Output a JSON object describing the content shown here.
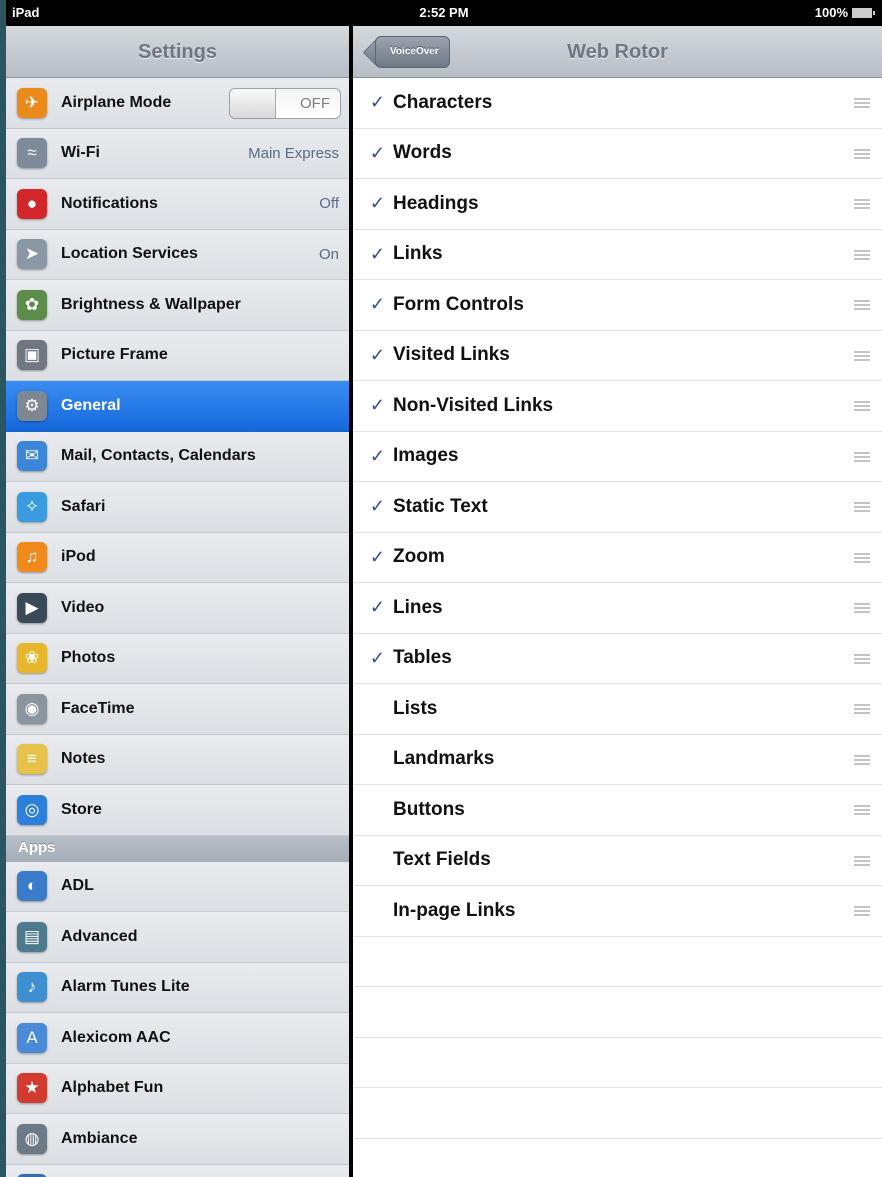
{
  "status": {
    "carrier": "iPad",
    "time": "2:52 PM",
    "battery": "100%"
  },
  "settings": {
    "title": "Settings",
    "items": [
      {
        "label": "Airplane Mode",
        "icon": "airplane-icon",
        "color": "#e98a1b",
        "glyph": "✈",
        "toggle": "OFF"
      },
      {
        "label": "Wi-Fi",
        "icon": "wifi-icon",
        "color": "#7d8a99",
        "glyph": "≈",
        "value": "Main Express"
      },
      {
        "label": "Notifications",
        "icon": "notifications-icon",
        "color": "#d2262a",
        "glyph": "●",
        "value": "Off"
      },
      {
        "label": "Location Services",
        "icon": "location-icon",
        "color": "#8a97a5",
        "glyph": "➤",
        "value": "On"
      },
      {
        "label": "Brightness & Wallpaper",
        "icon": "brightness-icon",
        "color": "#5b8c4a",
        "glyph": "✿"
      },
      {
        "label": "Picture Frame",
        "icon": "picture-frame-icon",
        "color": "#6f7780",
        "glyph": "▣"
      },
      {
        "label": "General",
        "icon": "gear-icon",
        "color": "#7c8792",
        "glyph": "⚙",
        "selected": true
      },
      {
        "label": "Mail, Contacts, Calendars",
        "icon": "mail-icon",
        "color": "#3b86d6",
        "glyph": "✉"
      },
      {
        "label": "Safari",
        "icon": "safari-icon",
        "color": "#3a9be0",
        "glyph": "✧"
      },
      {
        "label": "iPod",
        "icon": "ipod-icon",
        "color": "#f08a1c",
        "glyph": "♫"
      },
      {
        "label": "Video",
        "icon": "video-icon",
        "color": "#3a4957",
        "glyph": "▶"
      },
      {
        "label": "Photos",
        "icon": "photos-icon",
        "color": "#e7b62a",
        "glyph": "❀"
      },
      {
        "label": "FaceTime",
        "icon": "facetime-icon",
        "color": "#8a95a0",
        "glyph": "◉"
      },
      {
        "label": "Notes",
        "icon": "notes-icon",
        "color": "#e6c24b",
        "glyph": "≡"
      },
      {
        "label": "Store",
        "icon": "store-icon",
        "color": "#2d7fdc",
        "glyph": "◎"
      }
    ],
    "apps_header": "Apps",
    "apps": [
      {
        "label": "ADL",
        "icon": "adl-icon",
        "color": "#3a7cc9",
        "glyph": "◐"
      },
      {
        "label": "Advanced",
        "icon": "advanced-icon",
        "color": "#4d7a8c",
        "glyph": "▤"
      },
      {
        "label": "Alarm Tunes Lite",
        "icon": "alarm-tunes-icon",
        "color": "#3e8fd0",
        "glyph": "♪"
      },
      {
        "label": "Alexicom AAC",
        "icon": "alexicom-icon",
        "color": "#4a8ad8",
        "glyph": "A"
      },
      {
        "label": "Alphabet Fun",
        "icon": "alphabet-fun-icon",
        "color": "#d23b2f",
        "glyph": "★"
      },
      {
        "label": "Ambiance",
        "icon": "ambiance-icon",
        "color": "#6c7a88",
        "glyph": "◍"
      },
      {
        "label": "",
        "icon": "app-icon",
        "color": "#2f6fb0",
        "glyph": ""
      }
    ]
  },
  "web_rotor": {
    "back_label": "VoiceOver",
    "title": "Web Rotor",
    "checkmark": "✓",
    "items": [
      {
        "label": "Characters",
        "checked": true
      },
      {
        "label": "Words",
        "checked": true
      },
      {
        "label": "Headings",
        "checked": true
      },
      {
        "label": "Links",
        "checked": true
      },
      {
        "label": "Form Controls",
        "checked": true
      },
      {
        "label": "Visited Links",
        "checked": true
      },
      {
        "label": "Non-Visited Links",
        "checked": true
      },
      {
        "label": "Images",
        "checked": true
      },
      {
        "label": "Static Text",
        "checked": true
      },
      {
        "label": "Zoom",
        "checked": true
      },
      {
        "label": "Lines",
        "checked": true
      },
      {
        "label": "Tables",
        "checked": true
      },
      {
        "label": "Lists",
        "checked": false
      },
      {
        "label": "Landmarks",
        "checked": false
      },
      {
        "label": "Buttons",
        "checked": false
      },
      {
        "label": "Text Fields",
        "checked": false
      },
      {
        "label": "In-page Links",
        "checked": false
      }
    ]
  }
}
